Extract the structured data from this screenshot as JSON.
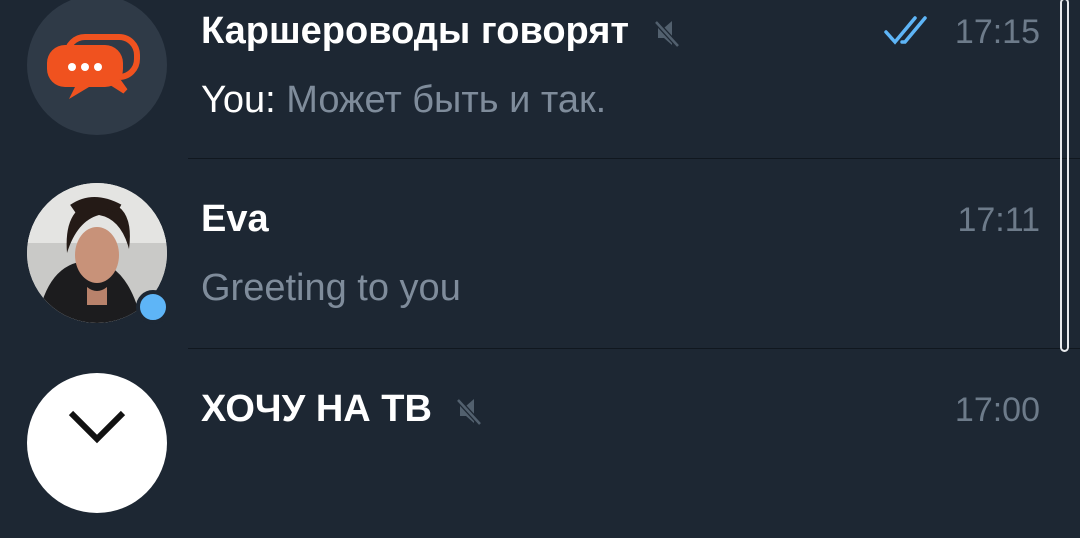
{
  "chats": [
    {
      "title": "Каршероводы говорят",
      "time": "17:15",
      "sender": "You:",
      "message": "Может быть и так.",
      "muted": true,
      "read": true,
      "avatar_icon": "chat-bubbles-icon",
      "avatar_color": "#2f3a47",
      "icon_color": "#f0521f"
    },
    {
      "title": "Eva",
      "time": "17:11",
      "message": "Greeting to you",
      "online": true,
      "avatar_icon": "person-photo"
    },
    {
      "title": "ХОЧУ НА ТВ",
      "time": "17:00",
      "muted": true,
      "avatar_icon": "x-logo-icon"
    }
  ],
  "colors": {
    "background": "#1d2733",
    "title": "#ffffff",
    "secondary": "#7f8c9b",
    "accent": "#5eb5f7"
  }
}
